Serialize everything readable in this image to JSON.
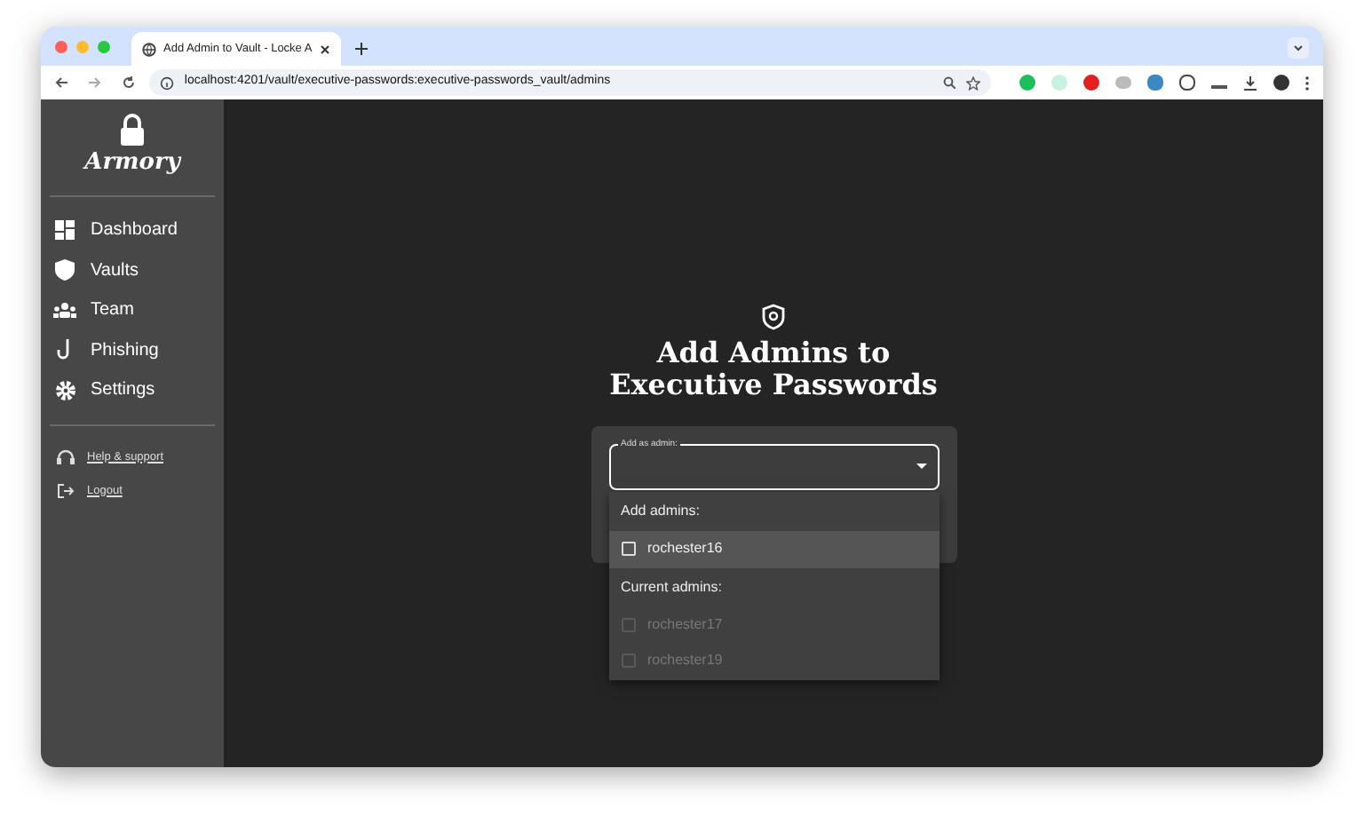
{
  "browser": {
    "tab_title": "Add Admin to Vault - Locke A",
    "url": "localhost:4201/vault/executive-passwords:executive-passwords_vault/admins"
  },
  "sidebar": {
    "logo": "Armory",
    "items": [
      {
        "label": "Dashboard",
        "kind": "dashboard"
      },
      {
        "label": "Vaults",
        "kind": "vaults"
      },
      {
        "label": "Team",
        "kind": "team"
      },
      {
        "label": "Phishing",
        "kind": "phishing"
      },
      {
        "label": "Settings",
        "kind": "settings"
      }
    ],
    "links": [
      {
        "label": "Help & support",
        "kind": "help"
      },
      {
        "label": "Logout",
        "kind": "logout"
      }
    ]
  },
  "main": {
    "title": "Add Admins to Executive Passwords",
    "field": {
      "label": "Add as admin:",
      "expanded": true
    },
    "dropdown": {
      "groups": [
        {
          "heading": "Add admins:",
          "options": [
            {
              "label": "rochester16",
              "checked": false,
              "disabled": false,
              "selected": true
            }
          ]
        },
        {
          "heading": "Current admins:",
          "options": [
            {
              "label": "rochester17",
              "checked": false,
              "disabled": true,
              "selected": false
            },
            {
              "label": "rochester19",
              "checked": false,
              "disabled": true,
              "selected": false
            }
          ]
        }
      ]
    }
  }
}
